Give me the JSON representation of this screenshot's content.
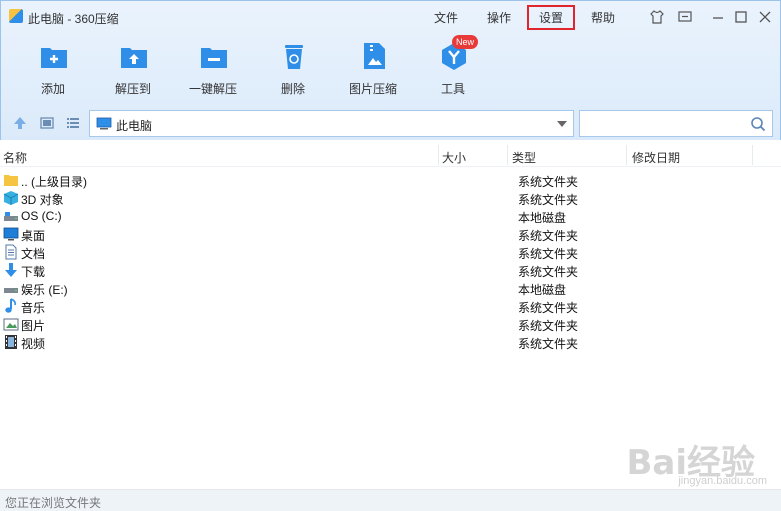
{
  "window": {
    "title": "此电脑 - 360压缩",
    "menus": [
      "文件",
      "操作",
      "设置",
      "帮助"
    ]
  },
  "toolbar": [
    {
      "label": "添加",
      "icon": "add-folder-icon"
    },
    {
      "label": "解压到",
      "icon": "extract-to-icon"
    },
    {
      "label": "一键解压",
      "icon": "one-click-extract-icon"
    },
    {
      "label": "删除",
      "icon": "recycle-bin-icon"
    },
    {
      "label": "图片压缩",
      "icon": "image-compress-icon"
    },
    {
      "label": "工具",
      "icon": "tools-icon",
      "badge": "New"
    }
  ],
  "address": {
    "text": "此电脑"
  },
  "search": {
    "placeholder": ""
  },
  "columns": [
    "名称",
    "大小",
    "类型",
    "修改日期"
  ],
  "rows": [
    {
      "name": ".. (上级目录)",
      "type": "系统文件夹",
      "icon": "folder-icon"
    },
    {
      "name": "3D 对象",
      "type": "系统文件夹",
      "icon": "3d-objects-icon"
    },
    {
      "name": "OS (C:)",
      "type": "本地磁盘",
      "icon": "drive-icon"
    },
    {
      "name": "桌面",
      "type": "系统文件夹",
      "icon": "desktop-icon"
    },
    {
      "name": "文档",
      "type": "系统文件夹",
      "icon": "document-icon"
    },
    {
      "name": "下载",
      "type": "系统文件夹",
      "icon": "download-icon"
    },
    {
      "name": "娱乐 (E:)",
      "type": "本地磁盘",
      "icon": "drive-icon"
    },
    {
      "name": "音乐",
      "type": "系统文件夹",
      "icon": "music-icon"
    },
    {
      "name": "图片",
      "type": "系统文件夹",
      "icon": "picture-icon"
    },
    {
      "name": "视频",
      "type": "系统文件夹",
      "icon": "video-icon"
    }
  ],
  "status": "您正在浏览文件夹",
  "watermark": {
    "main": "Bai经验",
    "sub": "jingyan.baidu.com"
  },
  "colors": {
    "accent": "#2f8ee8",
    "highlight": "#e0262c",
    "badge": "#e93a3a"
  }
}
